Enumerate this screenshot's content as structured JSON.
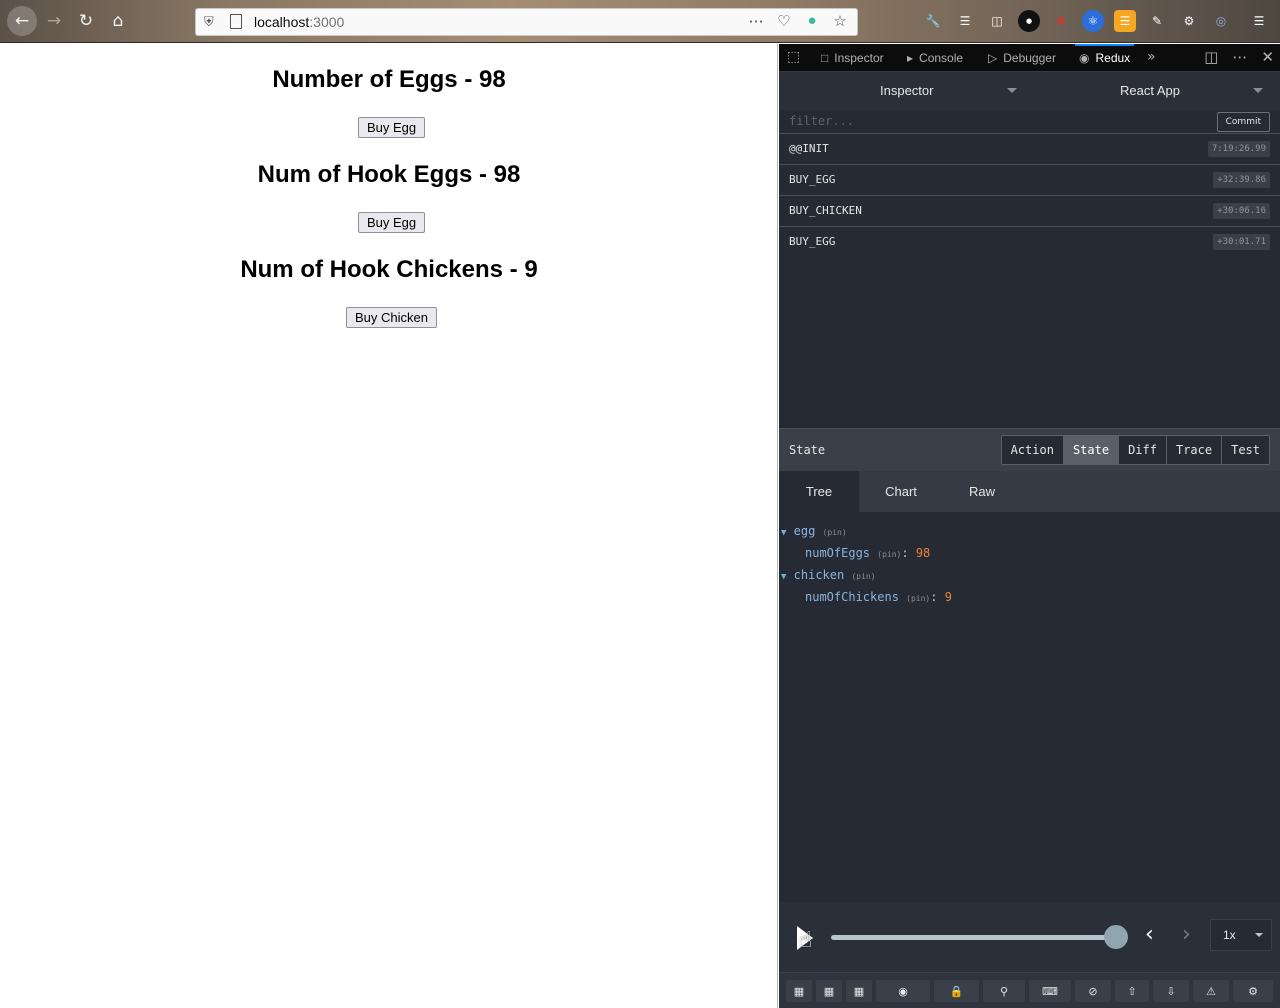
{
  "browser": {
    "url_host": "localhost",
    "url_port": ":3000"
  },
  "page": {
    "eggs_heading": "Number of Eggs - 98",
    "buy_egg_label": "Buy Egg",
    "hook_eggs_heading": "Num of Hook Eggs - 98",
    "buy_hook_egg_label": "Buy Egg",
    "hook_chickens_heading": "Num of Hook Chickens - 9",
    "buy_chicken_label": "Buy Chicken"
  },
  "devtools": {
    "tabs": [
      {
        "label": "Inspector",
        "icon": "inspector-icon"
      },
      {
        "label": "Console",
        "icon": "console-icon"
      },
      {
        "label": "Debugger",
        "icon": "debugger-icon"
      },
      {
        "label": "Redux",
        "icon": "redux-icon"
      }
    ],
    "active_tab": "Redux",
    "accent": "#0a84ff"
  },
  "redux": {
    "monitor_select": "Inspector",
    "instance_select": "React App",
    "filter_placeholder": "filter...",
    "commit_label": "Commit",
    "actions": [
      {
        "name": "@@INIT",
        "time": "7:19:26.99"
      },
      {
        "name": "BUY_EGG",
        "time": "+32:39.86"
      },
      {
        "name": "BUY_CHICKEN",
        "time": "+30:06.16"
      },
      {
        "name": "BUY_EGG",
        "time": "+30:01.71"
      }
    ],
    "state_label": "State",
    "view_tabs": [
      "Action",
      "State",
      "Diff",
      "Trace",
      "Test"
    ],
    "active_view": "State",
    "sub_tabs": [
      "Tree",
      "Chart",
      "Raw"
    ],
    "active_sub_tab": "Tree",
    "tree": [
      {
        "key": "egg",
        "pin": "(pin)",
        "child_key": "numOfEggs",
        "child_pin": "(pin)",
        "child_value": "98"
      },
      {
        "key": "chicken",
        "pin": "(pin)",
        "child_key": "numOfChickens",
        "child_pin": "(pin)",
        "child_value": "9"
      }
    ],
    "speed": "1x",
    "slider_position": 1.0,
    "value_color": "#e8843a",
    "key_color": "#8ab4dd"
  }
}
